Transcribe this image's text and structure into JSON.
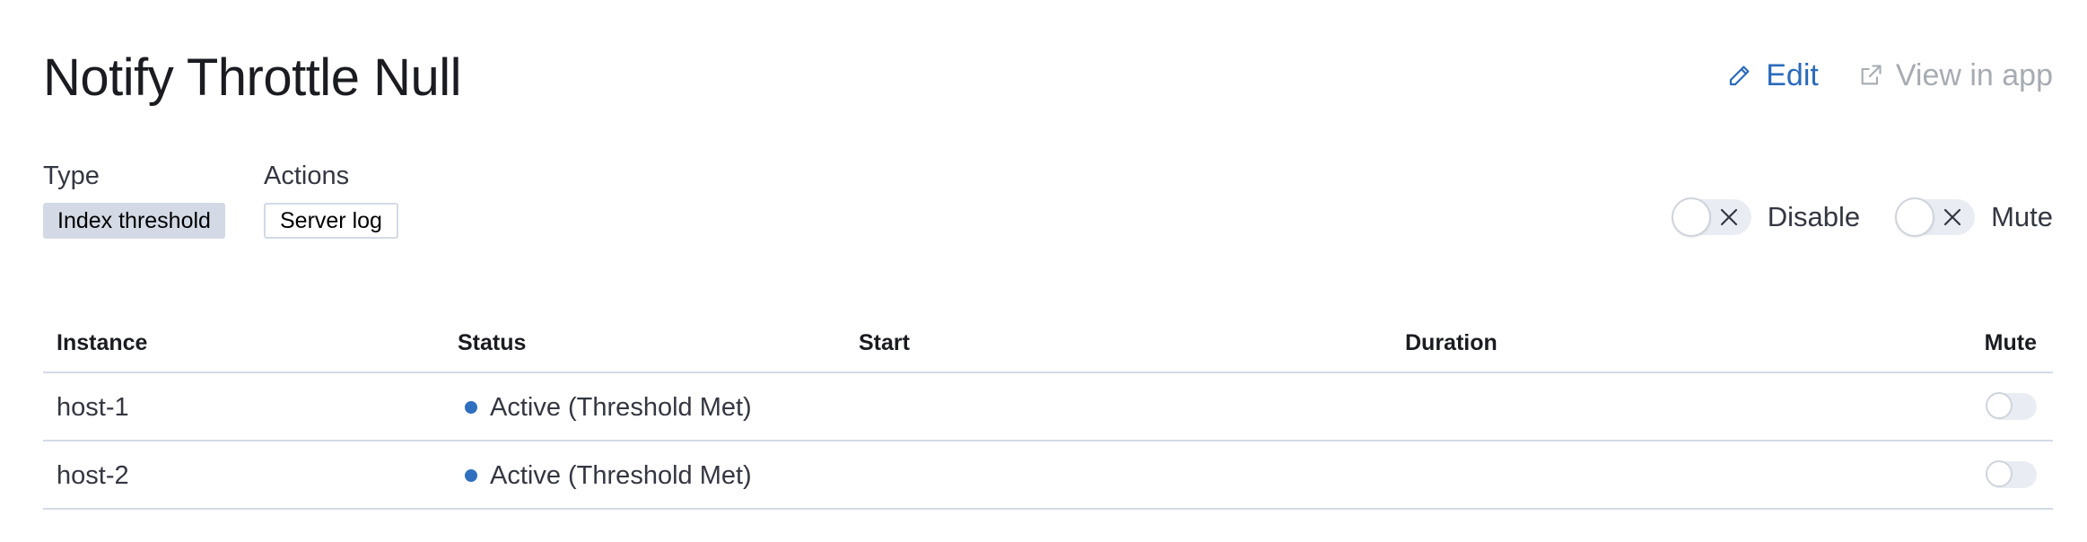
{
  "header": {
    "title": "Notify Throttle Null",
    "edit_label": "Edit",
    "view_in_app_label": "View in app"
  },
  "meta": {
    "type_label": "Type",
    "type_value": "Index threshold",
    "actions_label": "Actions",
    "actions_value": "Server log"
  },
  "switches": {
    "disable_label": "Disable",
    "disable_checked": false,
    "mute_label": "Mute",
    "mute_checked": false
  },
  "table": {
    "columns": [
      "Instance",
      "Status",
      "Start",
      "Duration",
      "Mute"
    ],
    "rows": [
      {
        "instance": "host-1",
        "status": "Active (Threshold Met)",
        "start": "",
        "duration": "",
        "muted": false
      },
      {
        "instance": "host-2",
        "status": "Active (Threshold Met)",
        "start": "",
        "duration": "",
        "muted": false
      }
    ]
  },
  "colors": {
    "link_blue": "#2b6bbd",
    "status_active": "#2f6fbf",
    "badge_gray": "#d3dae6",
    "disabled_text": "#a7abb2"
  },
  "icons": {
    "edit": "pencil-icon",
    "view_in_app": "external-link-icon",
    "switch_off": "close-icon",
    "status": "dot-icon"
  }
}
